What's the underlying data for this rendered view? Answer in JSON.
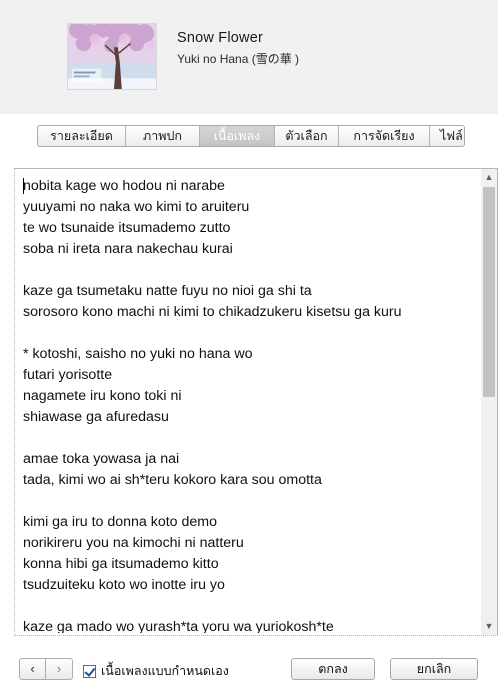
{
  "song": {
    "title": "Snow Flower",
    "subtitle": "Yuki no Hana (雪の華 )"
  },
  "artwork": {
    "icon": "album-artwork"
  },
  "tabs": [
    {
      "label": "รายละเอียด",
      "active": false
    },
    {
      "label": "ภาพปก",
      "active": false
    },
    {
      "label": "เนื้อเพลง",
      "active": true
    },
    {
      "label": "ตัวเลือก",
      "active": false
    },
    {
      "label": "การจัดเรียง",
      "active": false
    },
    {
      "label": "ไฟล์",
      "active": false
    }
  ],
  "lyrics": {
    "text": "nobita kage wo hodou ni narabe\nyuuyami no naka wo kimi to aruiteru\nte wo tsunaide itsumademo zutto\nsoba ni ireta nara nakechau kurai\n\nkaze ga tsumetaku natte fuyu no nioi ga shi ta\nsorosoro kono machi ni kimi to chikadzukeru kisetsu ga kuru\n\n* kotoshi, saisho no yuki no hana wo\nfutari yorisotte\nnagamete iru kono toki ni\nshiawase ga afuredasu\n\namae toka yowasa ja nai\ntada, kimi wo ai sh*teru kokoro kara sou omotta\n\nkimi ga iru to donna koto demo\nnorikireru you na kimochi ni natteru\nkonna hibi ga itsumademo kitto\ntsudzuiteku koto wo inotte iru yo\n\nkaze ga mado wo yurash*ta yoru wa yuriokosh*te"
  },
  "footer": {
    "prev_icon": "chevron-left-icon",
    "next_icon": "chevron-right-icon",
    "custom_lyrics_label": "เนื้อเพลงแบบกำหนดเอง",
    "custom_lyrics_checked": true,
    "ok_label": "ตกลง",
    "cancel_label": "ยกเลิก"
  }
}
